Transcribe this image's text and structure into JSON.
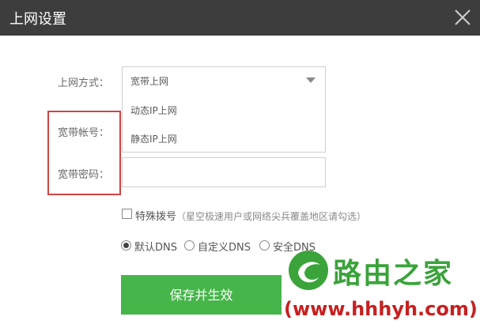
{
  "window": {
    "title": "上网设置"
  },
  "form": {
    "method_label": "上网方式：",
    "method_selected": "宽带上网",
    "method_options": [
      "动态IP上网",
      "静态IP上网"
    ],
    "account_label": "宽带帐号：",
    "password_label": "宽带密码：",
    "account_value": "",
    "password_value": "",
    "special_dial_label": "特殊拨号",
    "special_dial_hint": "（星空极速用户或网络尖兵覆盖地区请勾选）",
    "dns_options": [
      "默认DNS",
      "自定义DNS",
      "安全DNS"
    ],
    "dns_selected": "默认DNS",
    "save_label": "保存并生效"
  },
  "watermark": {
    "brand": "路由之家",
    "url": "(www.hhhyh.com)"
  },
  "colors": {
    "titlebar": "#3d3d3d",
    "save_button": "#46b54a",
    "highlight_box": "#d04444",
    "watermark_green": "#3aa33a",
    "watermark_red": "#c62020"
  },
  "icons": {
    "close": "close-icon",
    "dropdown": "chevron-down-icon",
    "logo": "router-home-logo-icon"
  }
}
